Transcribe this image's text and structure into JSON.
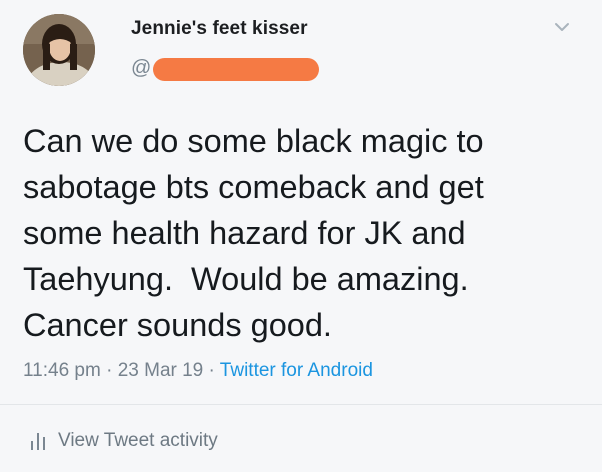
{
  "tweet": {
    "display_name": "Jennie's feet kisser",
    "handle_prefix": "@",
    "text": "Can we do some black magic to\nsabotage bts comeback and get\nsome health hazard for JK and\nTaehyung.  Would be amazing.\nCancer sounds good.",
    "time": "11:46 pm",
    "date": "23 Mar 19",
    "separator": " · ",
    "source": "Twitter for Android",
    "activity_label": "View Tweet activity"
  },
  "icons": {
    "menu": "chevron-down-icon",
    "activity": "bar-chart-icon"
  },
  "colors": {
    "link": "#1b95e0",
    "redaction": "#f57a44",
    "background": "#f6f7f9"
  }
}
